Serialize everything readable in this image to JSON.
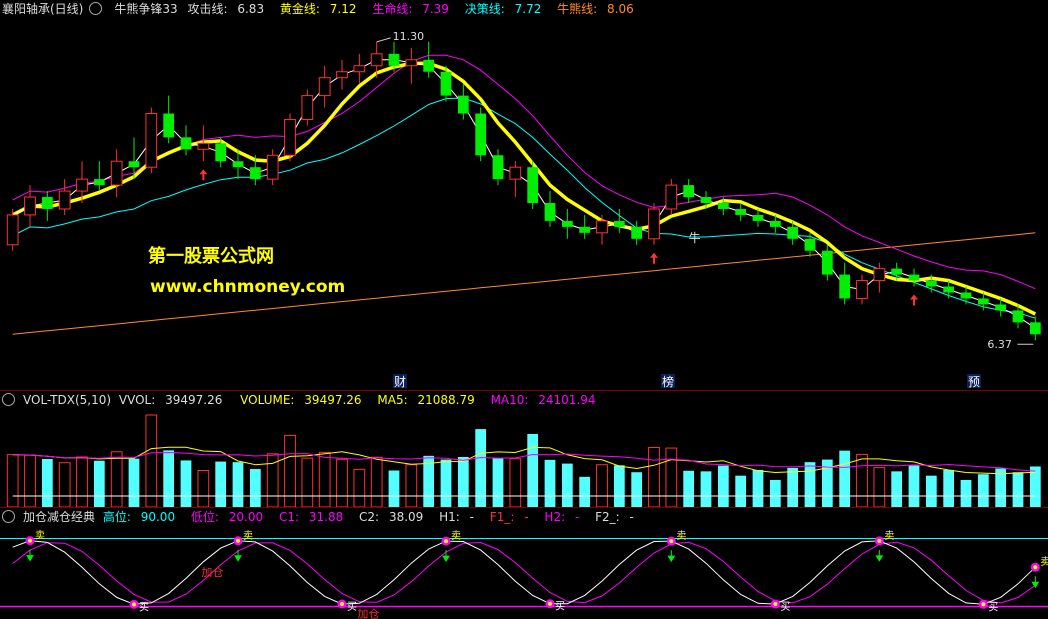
{
  "main_header": {
    "stock": "襄阳轴承(日线)",
    "indicator": "牛熊争锋33",
    "attack_label": "攻击线:",
    "attack_value": "6.83",
    "gold_label": "黄金线:",
    "gold_value": "7.12",
    "life_label": "生命线:",
    "life_value": "7.39",
    "decision_label": "决策线:",
    "decision_value": "7.72",
    "bullbear_label": "牛熊线:",
    "bullbear_value": "8.06"
  },
  "main_chart": {
    "high_label": "11.30",
    "low_label": "6.37",
    "bull_text": "牛",
    "watermark_cn": "第一股票公式网",
    "watermark_url": "www.chnmoney.com",
    "markers": [
      "财",
      "榜",
      "预"
    ]
  },
  "vol_header": {
    "name": "VOL-TDX(5,10)",
    "vvol_label": "VVOL:",
    "vvol_value": "39497.26",
    "volume_label": "VOLUME:",
    "volume_value": "39497.26",
    "ma5_label": "MA5:",
    "ma5_value": "21088.79",
    "ma10_label": "MA10:",
    "ma10_value": "24101.94"
  },
  "osc_header": {
    "name": "加仓减仓经典",
    "high_label": "高位:",
    "high_value": "90.00",
    "low_label": "低位:",
    "low_value": "20.00",
    "c1_label": "C1:",
    "c1_value": "31.88",
    "c2_label": "C2:",
    "c2_value": "38.09",
    "h1_label": "H1:",
    "h1_value": "-",
    "f1_label": "F1_:",
    "f1_value": "-",
    "h2_label": "H2:",
    "h2_value": "-",
    "f2_label": "F2_:",
    "f2_value": "-"
  },
  "osc_labels": {
    "add": "加仓",
    "buy": "买",
    "sell": "卖"
  },
  "colors": {
    "up": "#ff3232",
    "down": "#00ee00",
    "gold": "#ffff00",
    "life": "#ff00ff",
    "decision": "#00ffff",
    "bullbear": "#ff8c28",
    "vol_up": "#ff3232",
    "vol_down": "#54ffff"
  },
  "chart_data": [
    {
      "type": "candlestick",
      "title": "襄阳轴承(日线)",
      "series": [
        {
          "name": "攻击线",
          "last": 6.83
        },
        {
          "name": "黄金线",
          "last": 7.12
        },
        {
          "name": "生命线",
          "last": 7.39
        },
        {
          "name": "决策线",
          "last": 7.72
        },
        {
          "name": "牛熊线",
          "last": 8.06
        }
      ],
      "ylim": [
        5.6,
        11.6
      ],
      "annotations": [
        "11.30",
        "6.37"
      ],
      "ohlc": [
        [
          7.9,
          8.5,
          7.8,
          8.4
        ],
        [
          8.4,
          8.9,
          8.2,
          8.7
        ],
        [
          8.7,
          8.8,
          8.3,
          8.5
        ],
        [
          8.5,
          9.0,
          8.4,
          8.8
        ],
        [
          8.8,
          9.3,
          8.6,
          9.0
        ],
        [
          9.0,
          9.3,
          8.8,
          8.9
        ],
        [
          8.9,
          9.5,
          8.7,
          9.3
        ],
        [
          9.3,
          9.7,
          9.0,
          9.2
        ],
        [
          9.2,
          10.2,
          9.1,
          10.1
        ],
        [
          10.1,
          10.4,
          9.6,
          9.7
        ],
        [
          9.7,
          9.9,
          9.4,
          9.5
        ],
        [
          9.5,
          9.9,
          9.3,
          9.6
        ],
        [
          9.6,
          9.7,
          9.2,
          9.3
        ],
        [
          9.3,
          9.5,
          9.0,
          9.2
        ],
        [
          9.2,
          9.4,
          8.9,
          9.0
        ],
        [
          9.0,
          9.5,
          8.9,
          9.4
        ],
        [
          9.4,
          10.1,
          9.3,
          10.0
        ],
        [
          10.0,
          10.5,
          9.9,
          10.4
        ],
        [
          10.4,
          10.9,
          10.2,
          10.7
        ],
        [
          10.7,
          11.0,
          10.5,
          10.8
        ],
        [
          10.8,
          11.1,
          10.6,
          10.9
        ],
        [
          10.9,
          11.3,
          10.7,
          11.1
        ],
        [
          11.1,
          11.3,
          10.8,
          10.9
        ],
        [
          10.9,
          11.2,
          10.6,
          11.0
        ],
        [
          11.0,
          11.3,
          10.7,
          10.8
        ],
        [
          10.8,
          10.9,
          10.3,
          10.4
        ],
        [
          10.4,
          10.6,
          10.0,
          10.1
        ],
        [
          10.1,
          10.2,
          9.3,
          9.4
        ],
        [
          9.4,
          9.5,
          8.9,
          9.0
        ],
        [
          9.0,
          9.3,
          8.7,
          9.2
        ],
        [
          9.2,
          9.3,
          8.5,
          8.6
        ],
        [
          8.6,
          8.8,
          8.2,
          8.3
        ],
        [
          8.3,
          8.5,
          8.0,
          8.2
        ],
        [
          8.2,
          8.4,
          8.0,
          8.1
        ],
        [
          8.1,
          8.4,
          7.9,
          8.3
        ],
        [
          8.3,
          8.5,
          8.1,
          8.2
        ],
        [
          8.2,
          8.3,
          7.9,
          8.0
        ],
        [
          8.0,
          8.6,
          7.9,
          8.5
        ],
        [
          8.5,
          9.0,
          8.4,
          8.9
        ],
        [
          8.9,
          9.0,
          8.6,
          8.7
        ],
        [
          8.7,
          8.8,
          8.5,
          8.6
        ],
        [
          8.6,
          8.7,
          8.4,
          8.5
        ],
        [
          8.5,
          8.6,
          8.3,
          8.4
        ],
        [
          8.4,
          8.5,
          8.2,
          8.3
        ],
        [
          8.3,
          8.4,
          8.1,
          8.2
        ],
        [
          8.2,
          8.3,
          7.9,
          8.0
        ],
        [
          8.0,
          8.1,
          7.7,
          7.8
        ],
        [
          7.8,
          7.9,
          7.3,
          7.4
        ],
        [
          7.4,
          7.6,
          6.9,
          7.0
        ],
        [
          7.0,
          7.4,
          6.9,
          7.3
        ],
        [
          7.3,
          7.6,
          7.1,
          7.5
        ],
        [
          7.5,
          7.6,
          7.3,
          7.4
        ],
        [
          7.4,
          7.5,
          7.2,
          7.3
        ],
        [
          7.3,
          7.4,
          7.1,
          7.2
        ],
        [
          7.2,
          7.3,
          7.0,
          7.1
        ],
        [
          7.1,
          7.2,
          6.9,
          7.0
        ],
        [
          7.0,
          7.1,
          6.8,
          6.9
        ],
        [
          6.9,
          7.0,
          6.7,
          6.8
        ],
        [
          6.8,
          6.9,
          6.5,
          6.6
        ],
        [
          6.6,
          6.7,
          6.3,
          6.4
        ]
      ]
    },
    {
      "type": "bar",
      "title": "VOL-TDX(5,10)",
      "series": [
        {
          "name": "VOLUME",
          "last": 39497.26
        },
        {
          "name": "MA5",
          "last": 21088.79
        },
        {
          "name": "MA10",
          "last": 24101.94
        }
      ]
    },
    {
      "type": "line",
      "title": "加仓减仓经典",
      "series": [
        {
          "name": "高位",
          "last": 90.0
        },
        {
          "name": "低位",
          "last": 20.0
        },
        {
          "name": "C1",
          "last": 31.88
        },
        {
          "name": "C2",
          "last": 38.09
        }
      ]
    }
  ]
}
